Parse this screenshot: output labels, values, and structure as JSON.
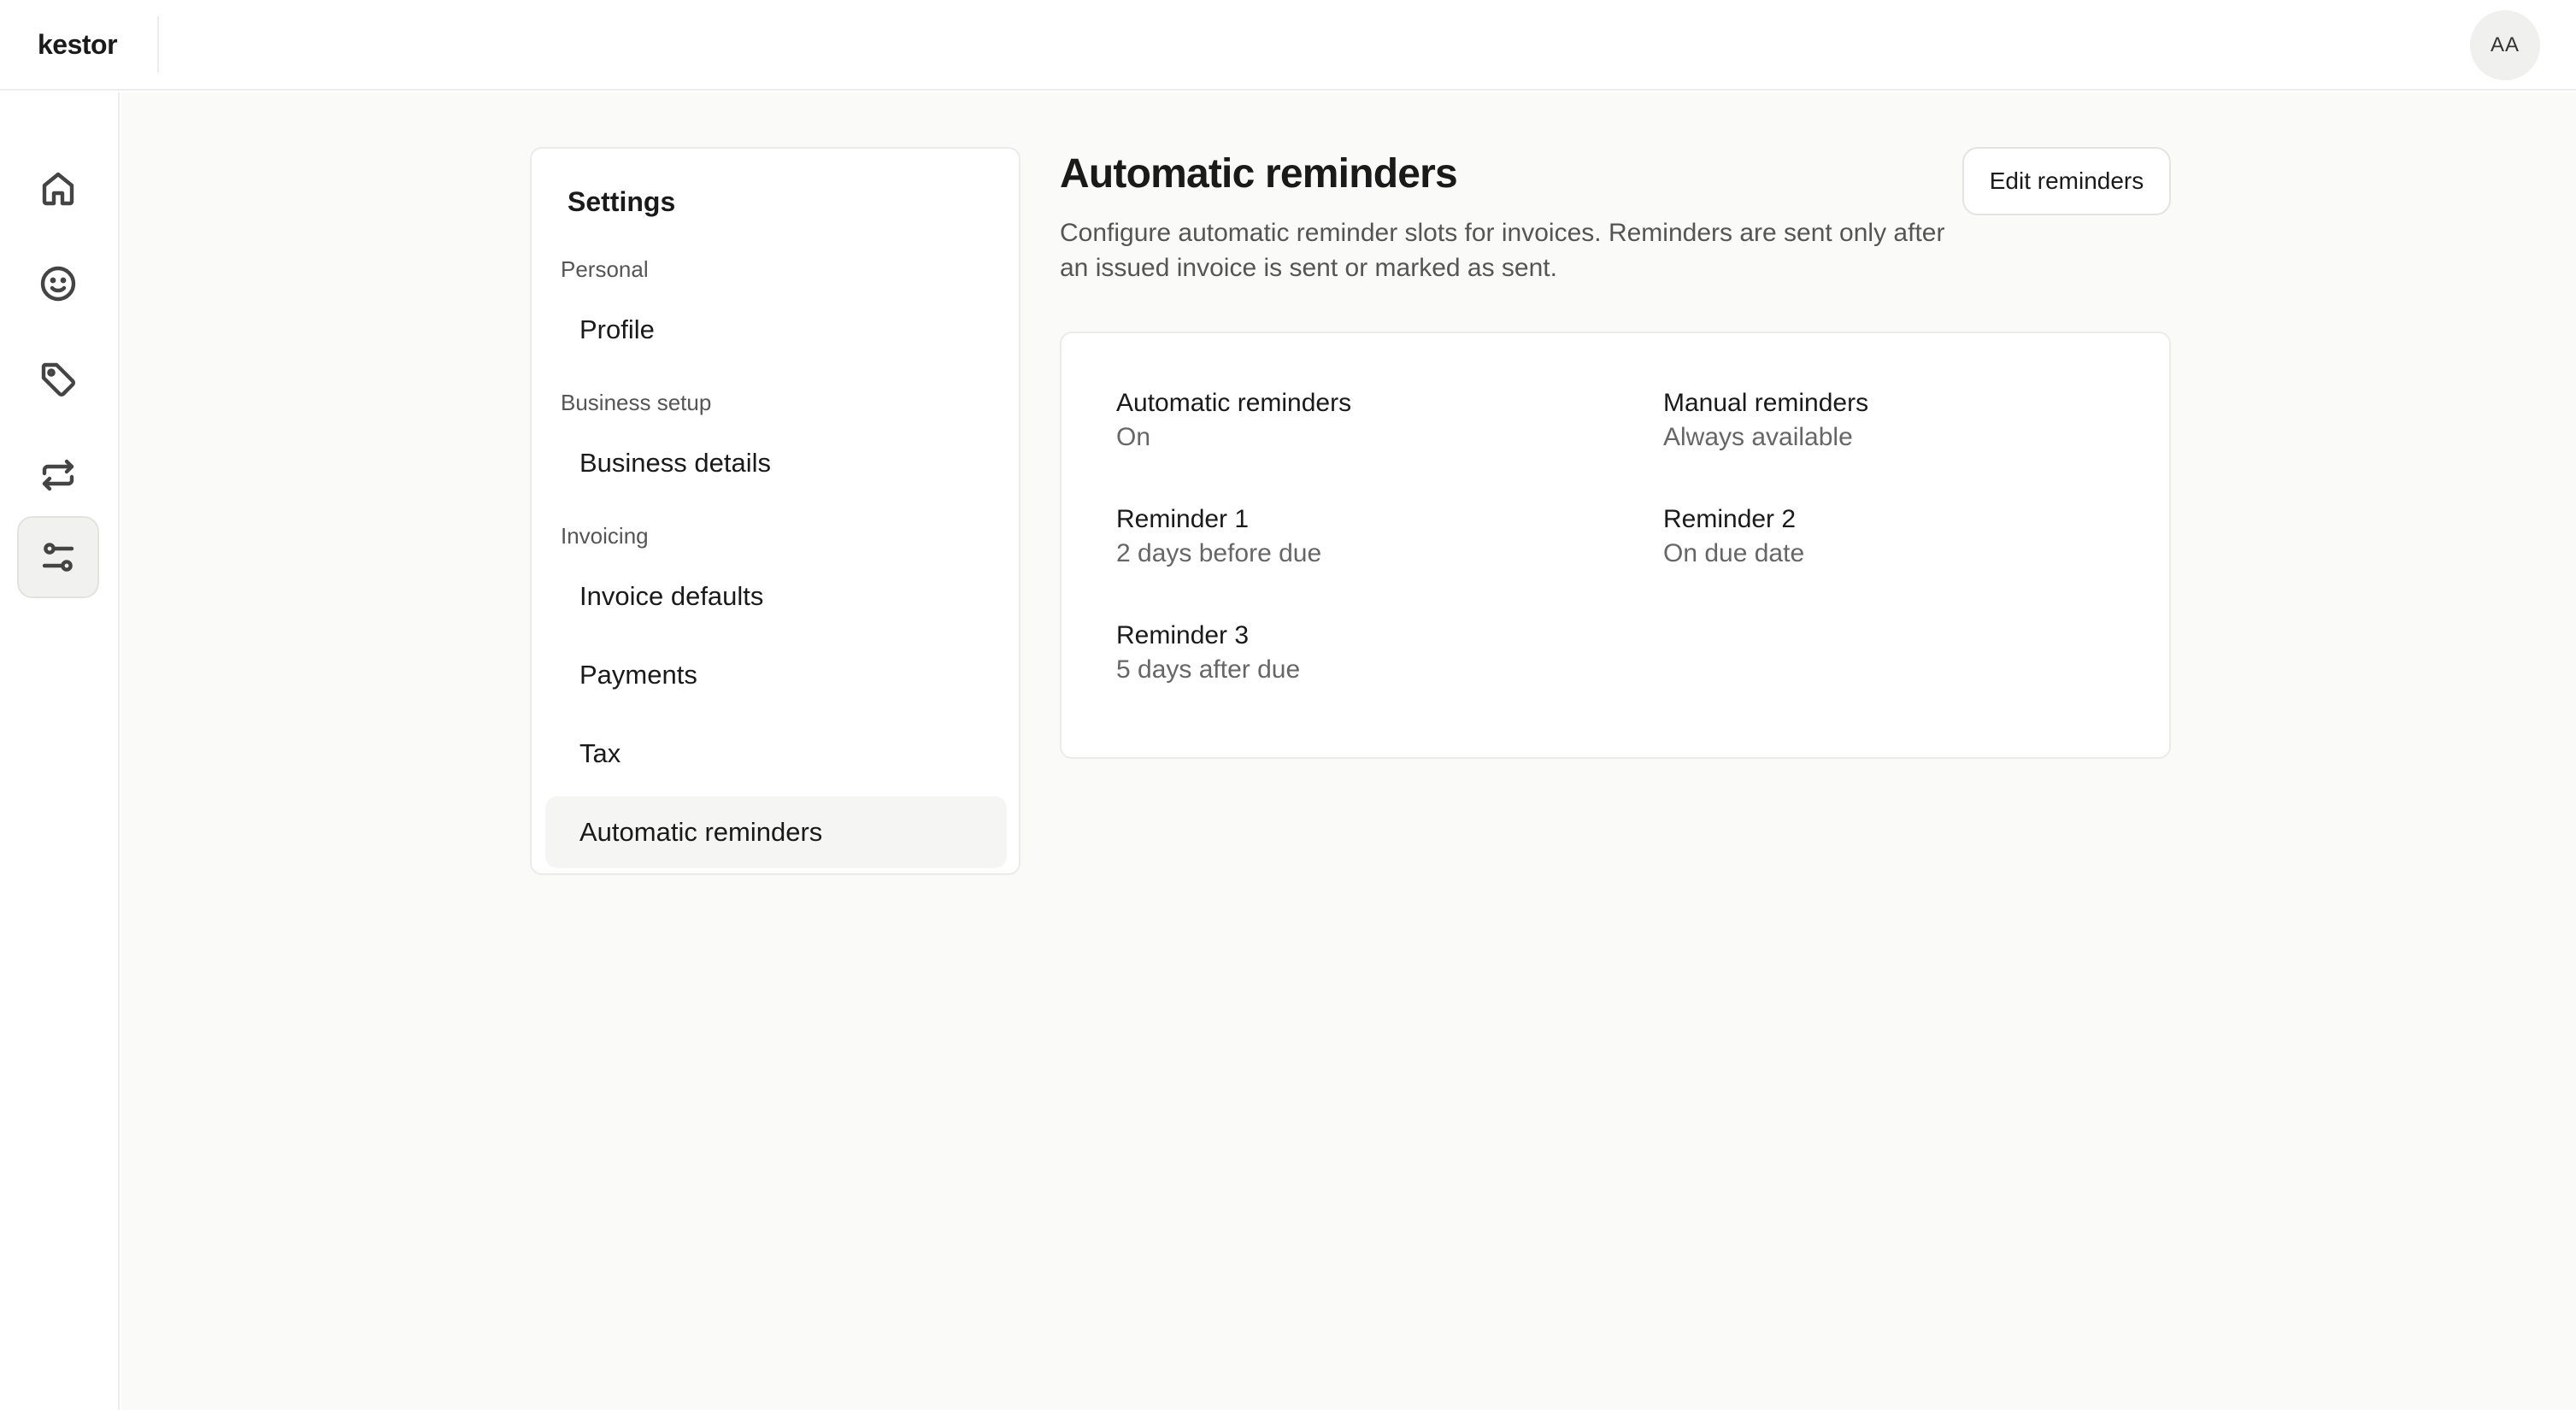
{
  "app": {
    "brand": "kestor",
    "avatar_initials": "AA"
  },
  "rail": {
    "items": [
      {
        "icon": "home-icon",
        "active": false
      },
      {
        "icon": "smiley-icon",
        "active": false
      },
      {
        "icon": "tag-icon",
        "active": false
      },
      {
        "icon": "repeat-icon",
        "active": false
      },
      {
        "icon": "sliders-icon",
        "active": true
      }
    ]
  },
  "settings_nav": {
    "title": "Settings",
    "groups": [
      {
        "label": "Personal",
        "items": [
          "Profile"
        ]
      },
      {
        "label": "Business setup",
        "items": [
          "Business details"
        ]
      },
      {
        "label": "Invoicing",
        "items": [
          "Invoice defaults",
          "Payments",
          "Tax",
          "Automatic reminders"
        ]
      }
    ],
    "active_item": "Automatic reminders"
  },
  "page": {
    "title": "Automatic reminders",
    "description": "Configure automatic reminder slots for invoices. Reminders are sent only after an issued invoice is sent or marked as sent.",
    "edit_button": "Edit reminders"
  },
  "reminders": [
    {
      "label": "Automatic reminders",
      "value": "On"
    },
    {
      "label": "Manual reminders",
      "value": "Always available"
    },
    {
      "label": "Reminder 1",
      "value": "2 days before due"
    },
    {
      "label": "Reminder 2",
      "value": "On due date"
    },
    {
      "label": "Reminder 3",
      "value": "5 days after due"
    }
  ]
}
